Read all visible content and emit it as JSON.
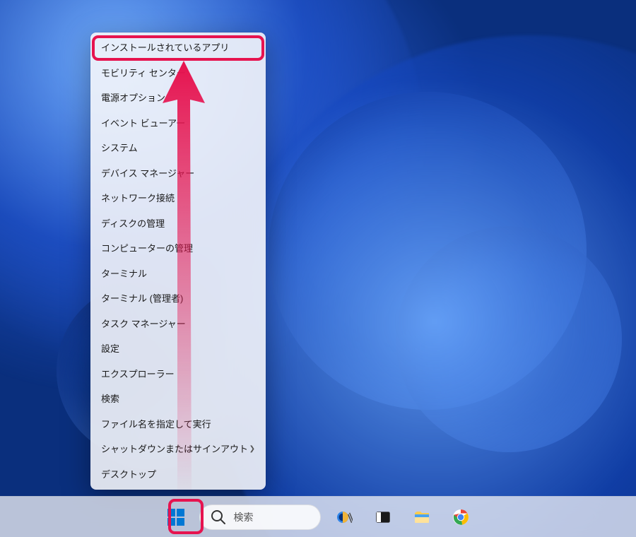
{
  "context_menu": {
    "items": [
      {
        "label": "インストールされているアプリ",
        "has_submenu": false,
        "highlighted": true
      },
      {
        "label": "モビリティ センター",
        "has_submenu": false
      },
      {
        "label": "電源オプション",
        "has_submenu": false
      },
      {
        "label": "イベント ビューアー",
        "has_submenu": false
      },
      {
        "label": "システム",
        "has_submenu": false
      },
      {
        "label": "デバイス マネージャー",
        "has_submenu": false
      },
      {
        "label": "ネットワーク接続",
        "has_submenu": false
      },
      {
        "label": "ディスクの管理",
        "has_submenu": false
      },
      {
        "label": "コンピューターの管理",
        "has_submenu": false
      },
      {
        "label": "ターミナル",
        "has_submenu": false
      },
      {
        "label": "ターミナル (管理者)",
        "has_submenu": false
      },
      {
        "label": "タスク マネージャー",
        "has_submenu": false
      },
      {
        "label": "設定",
        "has_submenu": false
      },
      {
        "label": "エクスプローラー",
        "has_submenu": false
      },
      {
        "label": "検索",
        "has_submenu": false
      },
      {
        "label": "ファイル名を指定して実行",
        "has_submenu": false
      },
      {
        "label": "シャットダウンまたはサインアウト",
        "has_submenu": true
      },
      {
        "label": "デスクトップ",
        "has_submenu": false
      }
    ]
  },
  "taskbar": {
    "search_placeholder": "検索",
    "icons": {
      "copilot": "copilot-icon",
      "taskview": "taskview-icon",
      "explorer": "file-explorer-icon",
      "chrome": "chrome-icon"
    }
  },
  "annotation": {
    "highlight_color": "#e6134f",
    "arrow_gradient_top": "#e6134f",
    "arrow_gradient_bottom": "rgba(230,19,79,0)"
  }
}
